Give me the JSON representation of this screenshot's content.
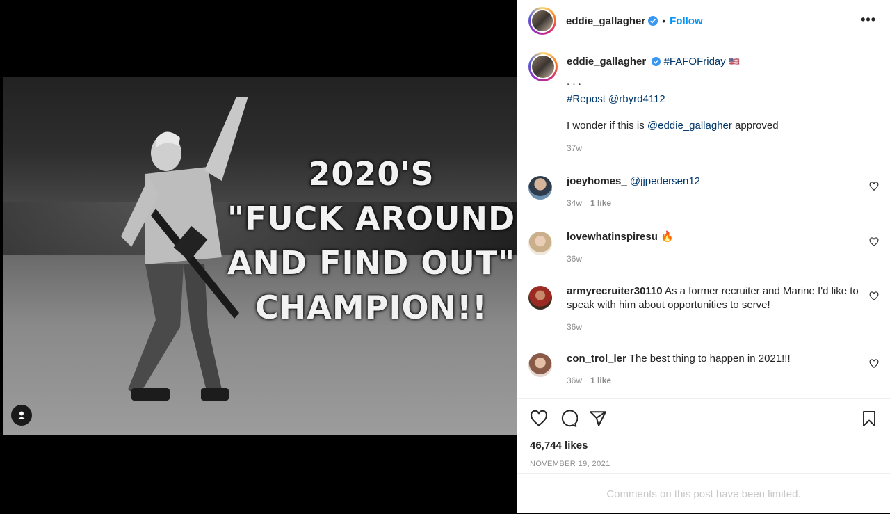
{
  "post": {
    "overlay_lines": [
      "2020'S",
      "\"FUCK AROUND",
      "AND FIND OUT\"",
      "CHAMPION!!"
    ]
  },
  "header": {
    "username": "eddie_gallagher",
    "dot": "•",
    "follow_label": "Follow",
    "more_label": "•••"
  },
  "caption": {
    "username": "eddie_gallagher",
    "hashtag": "#FAFOFriday",
    "flag": "🇺🇸",
    "dots": ". . .",
    "repost": "#Repost @rbyrd4112",
    "text_prefix": "I wonder if this is ",
    "mention": "@eddie_gallagher",
    "text_suffix": " approved",
    "time": "37w"
  },
  "comments": [
    {
      "username": "joeyhomes_",
      "text": "@jjpedersen12",
      "time": "34w",
      "likes": "1 like"
    },
    {
      "username": "lovewhatinspiresu",
      "text": "🔥",
      "time": "36w",
      "likes": ""
    },
    {
      "username": "armyrecruiter30110",
      "text": "As a former recruiter and Marine I'd like to speak with him about opportunities to serve!",
      "time": "36w",
      "likes": ""
    },
    {
      "username": "con_trol_ler",
      "text": "The best thing to happen in 2021!!!",
      "time": "36w",
      "likes": "1 like"
    }
  ],
  "footer": {
    "likes": "46,744 likes",
    "date": "NOVEMBER 19, 2021",
    "limited": "Comments on this post have been limited."
  },
  "colors": {
    "accent": "#0095f6",
    "link": "#00376b",
    "muted": "#8e8e8e",
    "verified": "#3897f0"
  },
  "icons": [
    "user-tag-icon",
    "verified-icon",
    "more-options-icon",
    "heart-icon",
    "comment-icon",
    "share-icon",
    "save-icon"
  ]
}
